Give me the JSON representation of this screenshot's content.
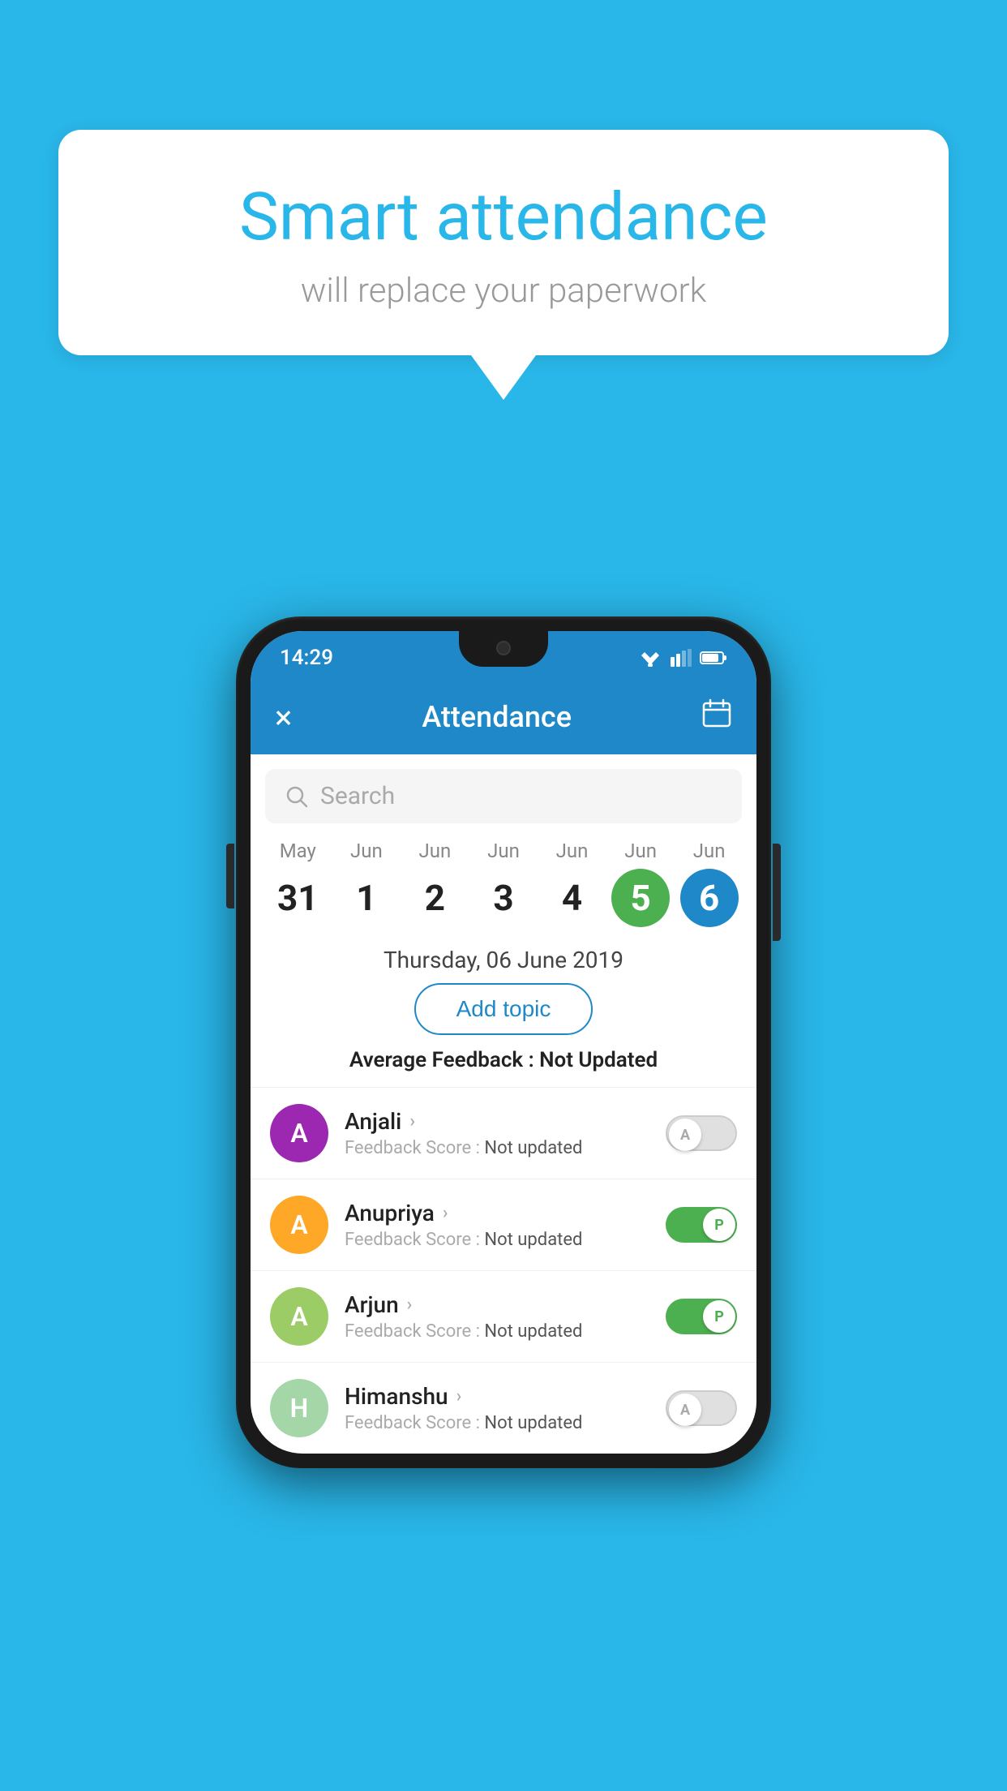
{
  "background_color": "#29b6e8",
  "speech_bubble": {
    "title": "Smart attendance",
    "subtitle": "will replace your paperwork"
  },
  "status_bar": {
    "time": "14:29"
  },
  "app_bar": {
    "title": "Attendance",
    "close_label": "×",
    "calendar_label": "📅"
  },
  "search": {
    "placeholder": "Search"
  },
  "dates": [
    {
      "month": "May",
      "day": "31",
      "state": "normal"
    },
    {
      "month": "Jun",
      "day": "1",
      "state": "normal"
    },
    {
      "month": "Jun",
      "day": "2",
      "state": "normal"
    },
    {
      "month": "Jun",
      "day": "3",
      "state": "normal"
    },
    {
      "month": "Jun",
      "day": "4",
      "state": "normal"
    },
    {
      "month": "Jun",
      "day": "5",
      "state": "today"
    },
    {
      "month": "Jun",
      "day": "6",
      "state": "selected"
    }
  ],
  "selected_date_label": "Thursday, 06 June 2019",
  "add_topic_label": "Add topic",
  "avg_feedback_prefix": "Average Feedback : ",
  "avg_feedback_value": "Not Updated",
  "students": [
    {
      "name": "Anjali",
      "avatar_letter": "A",
      "avatar_color": "#9c27b0",
      "feedback_prefix": "Feedback Score : ",
      "feedback_value": "Not updated",
      "toggle": "off",
      "toggle_letter": "A"
    },
    {
      "name": "Anupriya",
      "avatar_letter": "A",
      "avatar_color": "#ffa726",
      "feedback_prefix": "Feedback Score : ",
      "feedback_value": "Not updated",
      "toggle": "on",
      "toggle_letter": "P"
    },
    {
      "name": "Arjun",
      "avatar_letter": "A",
      "avatar_color": "#9ccc65",
      "feedback_prefix": "Feedback Score : ",
      "feedback_value": "Not updated",
      "toggle": "on",
      "toggle_letter": "P"
    },
    {
      "name": "Himanshu",
      "avatar_letter": "H",
      "avatar_color": "#a5d6a7",
      "feedback_prefix": "Feedback Score : ",
      "feedback_value": "Not updated",
      "toggle": "off",
      "toggle_letter": "A"
    }
  ]
}
